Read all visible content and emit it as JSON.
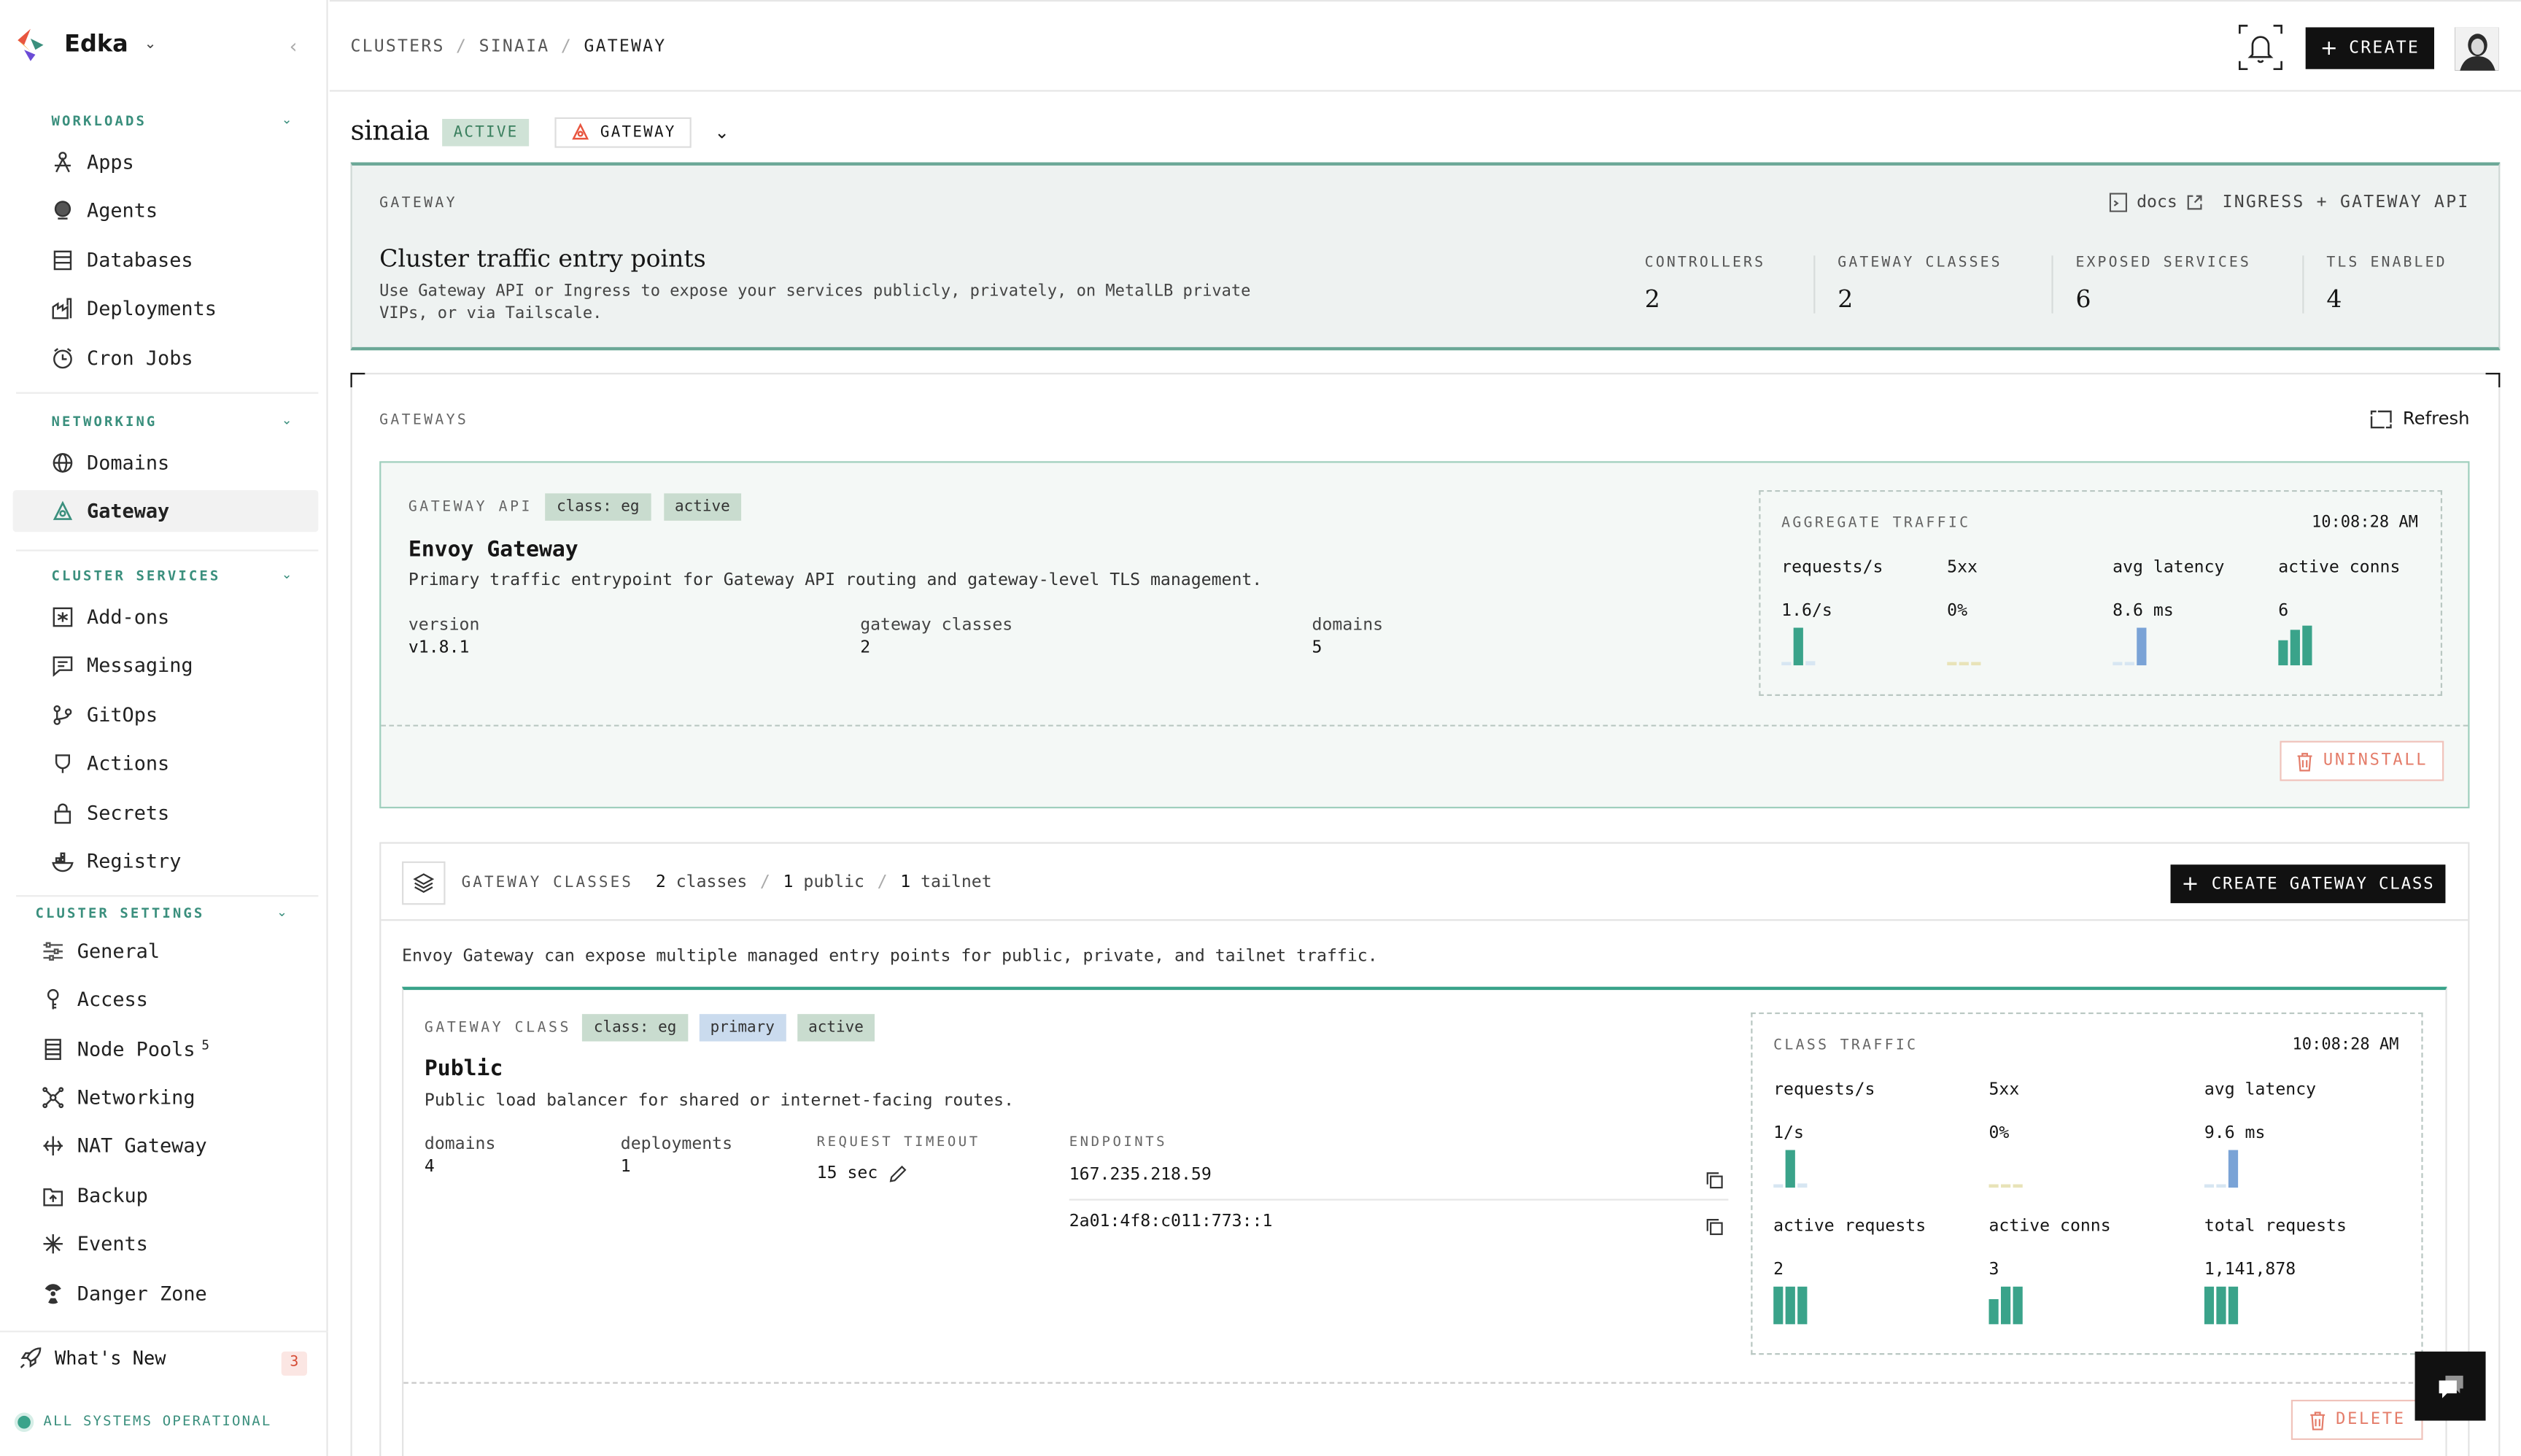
{
  "app": {
    "org_name": "Edka",
    "brand_colors": [
      "#e8553f",
      "#f3a93b",
      "#3a8f7d",
      "#6b4bd6"
    ]
  },
  "sidebar": {
    "sections": [
      {
        "title": "WORKLOADS",
        "items": [
          {
            "label": "Apps",
            "icon": "apps-icon"
          },
          {
            "label": "Agents",
            "icon": "agents-icon"
          },
          {
            "label": "Databases",
            "icon": "database-icon"
          },
          {
            "label": "Deployments",
            "icon": "deployments-icon"
          },
          {
            "label": "Cron Jobs",
            "icon": "clock-icon"
          }
        ]
      },
      {
        "title": "NETWORKING",
        "items": [
          {
            "label": "Domains",
            "icon": "globe-icon"
          },
          {
            "label": "Gateway",
            "icon": "gateway-icon",
            "active": true
          }
        ]
      },
      {
        "title": "CLUSTER SERVICES",
        "items": [
          {
            "label": "Add-ons",
            "icon": "addons-icon"
          },
          {
            "label": "Messaging",
            "icon": "message-icon"
          },
          {
            "label": "GitOps",
            "icon": "git-icon"
          },
          {
            "label": "Actions",
            "icon": "actions-icon"
          },
          {
            "label": "Secrets",
            "icon": "lock-icon"
          },
          {
            "label": "Registry",
            "icon": "registry-icon"
          }
        ]
      },
      {
        "title": "CLUSTER SETTINGS",
        "items": [
          {
            "label": "General",
            "icon": "sliders-icon"
          },
          {
            "label": "Access",
            "icon": "key-icon"
          },
          {
            "label": "Node Pools",
            "icon": "server-icon",
            "count": "5"
          },
          {
            "label": "Networking",
            "icon": "network-icon"
          },
          {
            "label": "NAT Gateway",
            "icon": "nat-icon"
          },
          {
            "label": "Backup",
            "icon": "backup-icon"
          },
          {
            "label": "Events",
            "icon": "events-icon"
          },
          {
            "label": "Danger Zone",
            "icon": "danger-icon"
          }
        ]
      }
    ],
    "whats_new": {
      "label": "What's New",
      "count": "3"
    },
    "status": "ALL SYSTEMS OPERATIONAL"
  },
  "topbar": {
    "breadcrumb": [
      "CLUSTERS",
      "SINAIA",
      "GATEWAY"
    ],
    "create_label": "CREATE"
  },
  "page": {
    "cluster_name": "sinaia",
    "status": "ACTIVE",
    "section_select": "GATEWAY"
  },
  "hero": {
    "label": "GATEWAY",
    "docs_label": "docs",
    "tag": "INGRESS + GATEWAY API",
    "title": "Cluster traffic entry points",
    "description": "Use Gateway API or Ingress to expose your services publicly, privately, on MetalLB private VIPs, or via Tailscale.",
    "stats": [
      {
        "label": "CONTROLLERS",
        "value": "2"
      },
      {
        "label": "GATEWAY CLASSES",
        "value": "2"
      },
      {
        "label": "EXPOSED SERVICES",
        "value": "6"
      },
      {
        "label": "TLS ENABLED",
        "value": "4"
      }
    ]
  },
  "gateways": {
    "label": "GATEWAYS",
    "refresh_label": "Refresh",
    "controller": {
      "kind": "GATEWAY API",
      "class_chip": "class: eg",
      "status_chip": "active",
      "name": "Envoy Gateway",
      "description": "Primary traffic entrypoint for Gateway API routing and gateway-level TLS management.",
      "props": [
        {
          "key": "version",
          "value": "v1.8.1"
        },
        {
          "key": "gateway classes",
          "value": "2"
        },
        {
          "key": "domains",
          "value": "5"
        }
      ],
      "traffic": {
        "label": "AGGREGATE TRAFFIC",
        "time": "10:08:28 AM",
        "metrics": [
          {
            "key": "requests/s",
            "value": "1.6/s",
            "color": "#3aa38a",
            "bars": [
              0.08,
              0.9,
              0.1
            ]
          },
          {
            "key": "5xx",
            "value": "0%",
            "color": "#e8e3b8",
            "bars": [
              0.08,
              0.08,
              0.08
            ]
          },
          {
            "key": "avg latency",
            "value": "8.6 ms",
            "color": "#7aa3d6",
            "bars": [
              0.08,
              0.08,
              0.9
            ]
          },
          {
            "key": "active conns",
            "value": "6",
            "color": "#3aa38a",
            "bars": [
              0.6,
              0.85,
              0.95
            ]
          }
        ]
      },
      "uninstall_label": "UNINSTALL"
    },
    "classes": {
      "label": "GATEWAY CLASSES",
      "count": "2",
      "count_label": "classes",
      "public": "1",
      "public_label": "public",
      "tailnet": "1",
      "tailnet_label": "tailnet",
      "create_label": "CREATE GATEWAY CLASS",
      "description": "Envoy Gateway can expose multiple managed entry points for public, private, and tailnet traffic.",
      "items": [
        {
          "kind": "GATEWAY CLASS",
          "chips": [
            "class: eg",
            "primary",
            "active"
          ],
          "name": "Public",
          "description": "Public load balancer for shared or internet-facing routes.",
          "domains_label": "domains",
          "domains": "4",
          "deployments_label": "deployments",
          "deployments": "1",
          "timeout_label": "REQUEST TIMEOUT",
          "timeout": "15 sec",
          "endpoints_label": "ENDPOINTS",
          "endpoints": [
            "167.235.218.59",
            "2a01:4f8:c011:773::1"
          ],
          "traffic": {
            "label": "CLASS TRAFFIC",
            "time": "10:08:28 AM",
            "metrics": [
              {
                "key": "requests/s",
                "value": "1/s",
                "color": "#3aa38a",
                "bars": [
                  0.08,
                  0.9,
                  0.1
                ]
              },
              {
                "key": "5xx",
                "value": "0%",
                "color": "#e8e3b8",
                "bars": [
                  0.08,
                  0.08,
                  0.08
                ]
              },
              {
                "key": "avg latency",
                "value": "9.6 ms",
                "color": "#7aa3d6",
                "bars": [
                  0.08,
                  0.08,
                  0.9
                ]
              },
              {
                "key": "active requests",
                "value": "2",
                "color": "#3aa38a",
                "bars": [
                  0.9,
                  0.9,
                  0.9
                ]
              },
              {
                "key": "active conns",
                "value": "3",
                "color": "#3aa38a",
                "bars": [
                  0.6,
                  0.9,
                  0.9
                ]
              },
              {
                "key": "total requests",
                "value": "1,141,878",
                "color": "#3aa38a",
                "bars": [
                  0.9,
                  0.9,
                  0.9
                ]
              }
            ]
          },
          "delete_label": "DELETE"
        }
      ]
    }
  }
}
